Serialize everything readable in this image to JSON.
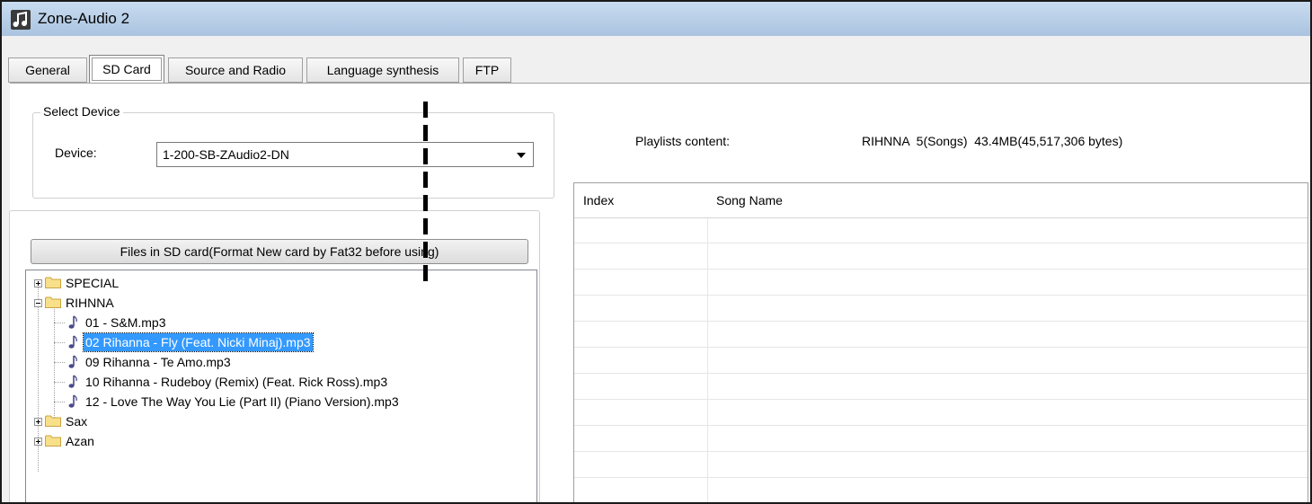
{
  "window": {
    "title": "Zone-Audio 2"
  },
  "tabs": [
    {
      "label": "General",
      "active": false
    },
    {
      "label": "SD Card",
      "active": true
    },
    {
      "label": "Source and Radio",
      "active": false
    },
    {
      "label": "Language synthesis",
      "active": false
    },
    {
      "label": "FTP",
      "active": false
    }
  ],
  "select_device": {
    "group_title": "Select Device",
    "device_label": "Device:",
    "device_value": "1-200-SB-ZAudio2-DN"
  },
  "files": {
    "button_label": "Files in SD card(Format New card by Fat32 before using)",
    "tree": [
      {
        "type": "folder",
        "label": "SPECIAL",
        "expanded": false
      },
      {
        "type": "folder",
        "label": "RIHNNA",
        "expanded": true
      },
      {
        "type": "file",
        "label": "01 - S&M.mp3"
      },
      {
        "type": "file",
        "label": "02 Rihanna - Fly (Feat. Nicki Minaj).mp3",
        "selected": true
      },
      {
        "type": "file",
        "label": "09 Rihanna - Te Amo.mp3"
      },
      {
        "type": "file",
        "label": "10 Rihanna - Rudeboy (Remix) (Feat. Rick Ross).mp3"
      },
      {
        "type": "file",
        "label": "12 - Love The Way You Lie (Part II) (Piano Version).mp3"
      },
      {
        "type": "folder",
        "label": "Sax",
        "expanded": false
      },
      {
        "type": "folder",
        "label": "Azan",
        "expanded": false
      }
    ]
  },
  "playlist": {
    "label": "Playlists content:",
    "summary": "RIHNNA  5(Songs)  43.4MB(45,517,306 bytes)"
  },
  "grid": {
    "columns": [
      "Index",
      "Song Name"
    ],
    "rows": []
  },
  "colors": {
    "selection": "#3399ff",
    "titlebar": "#b6cde6"
  }
}
